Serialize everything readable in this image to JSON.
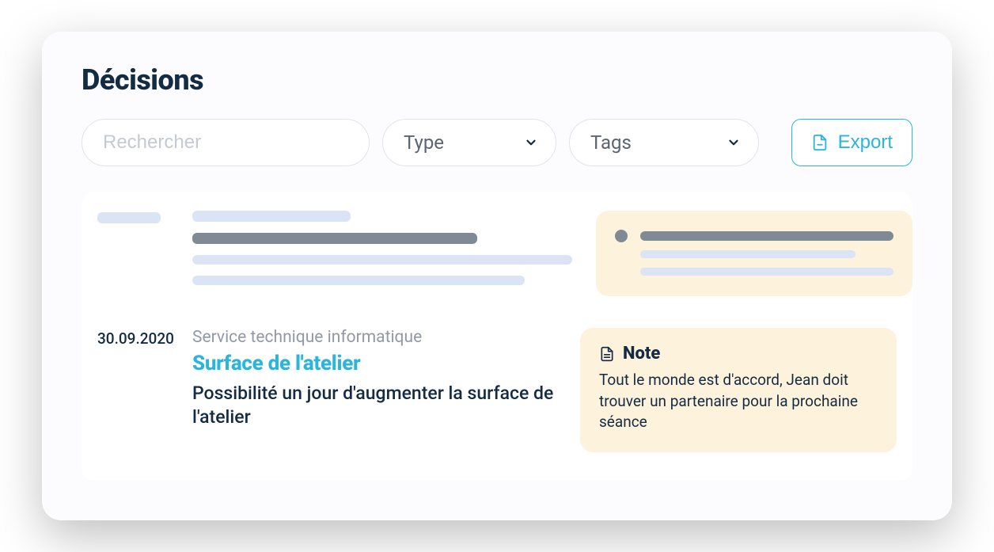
{
  "header": {
    "title": "Décisions"
  },
  "toolbar": {
    "search_placeholder": "Rechercher",
    "type_label": "Type",
    "tags_label": "Tags",
    "export_label": "Export"
  },
  "decisions": [
    {
      "date": "30.09.2020",
      "service": "Service technique informatique",
      "title": "Surface de l'atelier",
      "description": "Possibilité un jour d'augmenter la surface de l'atelier",
      "note": {
        "label": "Note",
        "body": "Tout le monde est d'accord, Jean doit trouver un partenaire pour la prochaine séance"
      }
    }
  ]
}
